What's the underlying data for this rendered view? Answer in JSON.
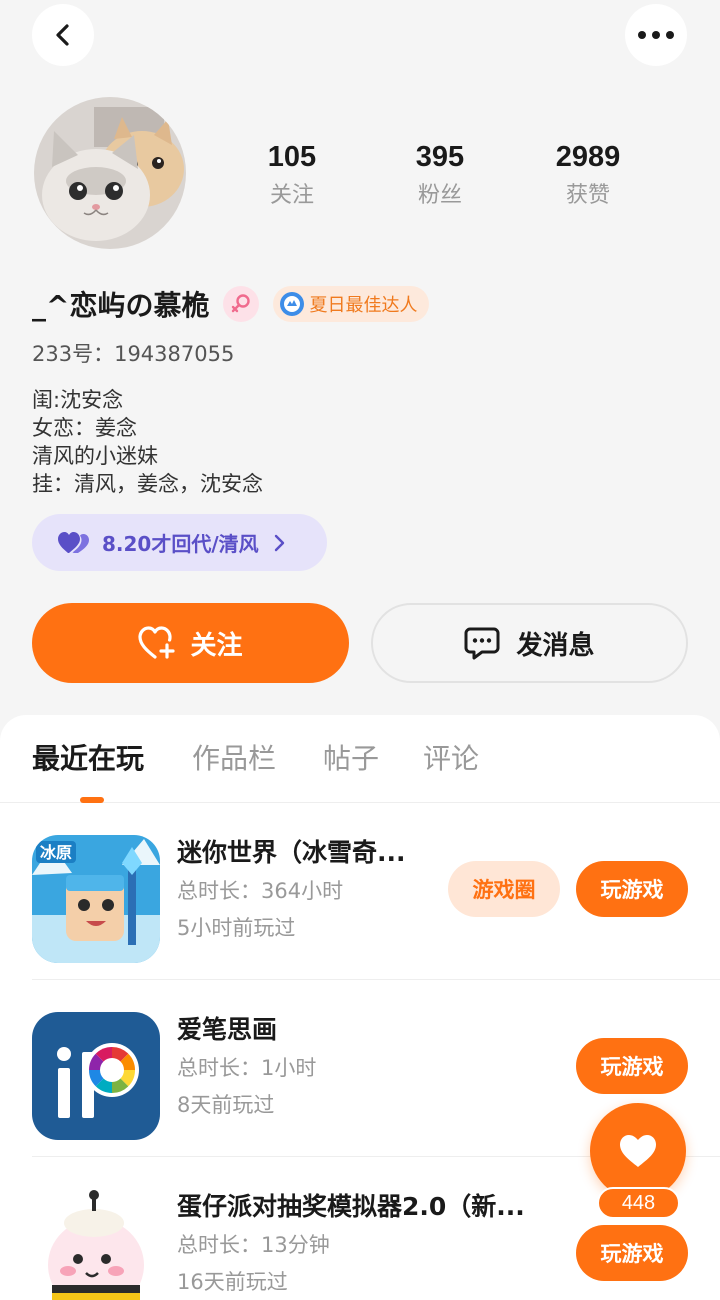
{
  "header": {
    "back_icon": "chevron-left-icon",
    "more_icon": "more-dots-icon"
  },
  "profile": {
    "stats": [
      {
        "num": "105",
        "label": "关注"
      },
      {
        "num": "395",
        "label": "粉丝"
      },
      {
        "num": "2989",
        "label": "获赞"
      }
    ],
    "nickname": "_^恋屿の慕桅",
    "gender_icon": "female-icon",
    "title_badge": "夏日最佳达人",
    "account_id": "233号：194387055",
    "bio_lines": [
      "闺:沈安念",
      "女恋：姜念",
      "清风的小迷妹",
      "挂：清风，姜念，沈安念"
    ],
    "tag": "8.20才回代/清风",
    "follow_label": "关注",
    "message_label": "发消息"
  },
  "tabs": [
    "最近在玩",
    "作品栏",
    "帖子",
    "评论"
  ],
  "active_tab": "最近在玩",
  "games": [
    {
      "title": "迷你世界（冰雪奇...",
      "duration": "总时长：364小时",
      "last_played": "5小时前玩过",
      "circle_label": "游戏圈",
      "play_label": "玩游戏"
    },
    {
      "title": "爱笔思画",
      "duration": "总时长：1小时",
      "last_played": "8天前玩过",
      "play_label": "玩游戏"
    },
    {
      "title": "蛋仔派对抽奖模拟器2.0（新...",
      "duration": "总时长：13分钟",
      "last_played": "16天前玩过",
      "play_label": "玩游戏"
    }
  ],
  "floating": {
    "like_count": "448",
    "icon": "heart-icon"
  },
  "colors": {
    "accent": "#ff7112",
    "tag_bg": "#e6e3fa",
    "tag_text": "#5a4fc7"
  }
}
